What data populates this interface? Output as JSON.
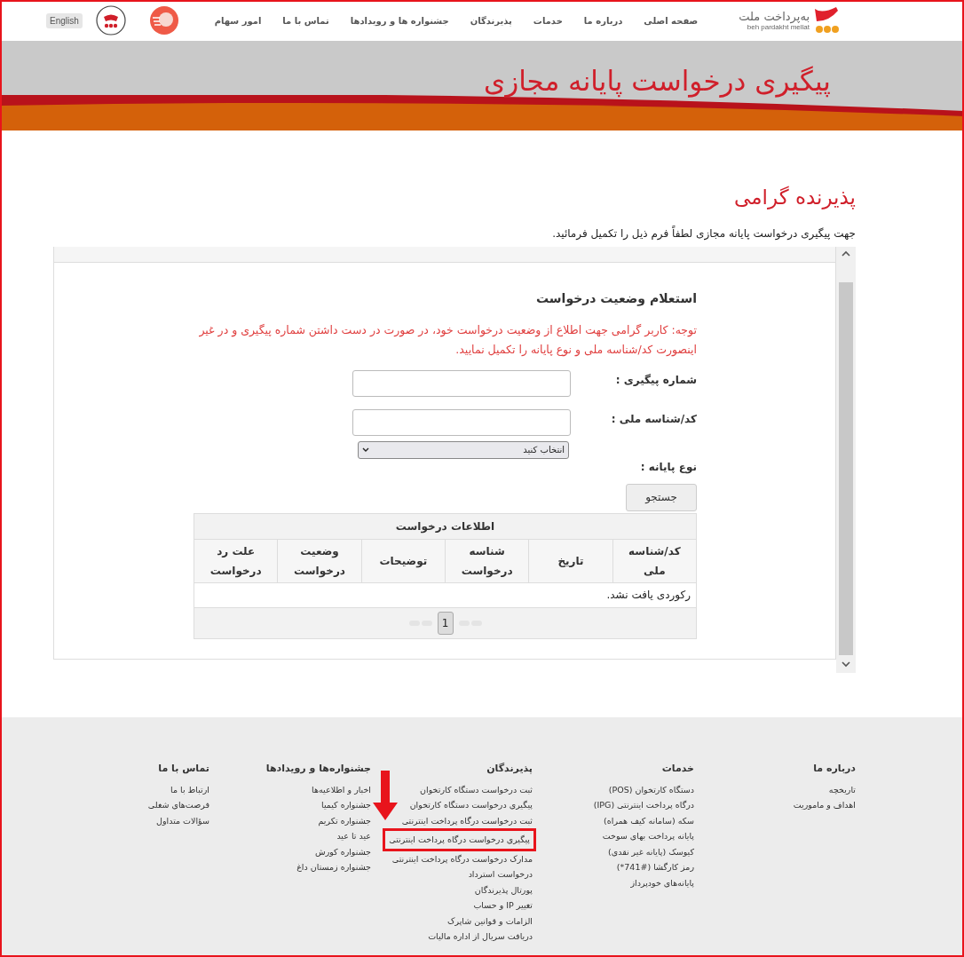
{
  "nav": {
    "logo": {
      "name": "به‌پرداخت ملت",
      "latin": "beh pardakht mellat"
    },
    "items": [
      "صفحه اصلی",
      "درباره ما",
      "خدمات",
      "پذیرندگان",
      "جشنواره ها و رویدادها",
      "تماس با ما",
      "امور سهام"
    ],
    "language": "English"
  },
  "header": {
    "title": "پیگیری درخواست پایانه مجازی"
  },
  "greeting": "پذیرنده گرامی",
  "intro": "جهت پیگیری درخواست پایانه مجازی لطفاً فرم ذیل را تکمیل فرمائید.",
  "form": {
    "title": "استعلام وضعیت درخواست",
    "notice": "توجه: کاربر گرامی جهت اطلاع از وضعیت درخواست خود، در صورت در دست داشتن شماره پیگیری و در غیر اینصورت کد/شناسه ملی و نوع پایانه را تکمیل نمایید.",
    "fields": [
      {
        "kind": "text",
        "label": "شماره پیگیری :"
      },
      {
        "kind": "text",
        "label": "کد/شناسه ملی :"
      },
      {
        "kind": "select",
        "label": "نوع پایانه :",
        "value": "انتخاب کنید"
      }
    ],
    "search_button": "جستجو"
  },
  "table": {
    "caption": "اطلاعات درخواست",
    "columns": [
      "کد/شناسه ملی",
      "تاریخ",
      "شناسه درخواست",
      "توضیحات",
      "وضعیت درخواست",
      "علت رد درخواست"
    ],
    "empty_message": "رکوردی یافت نشد.",
    "pages": [
      {
        "label": "1",
        "selected": true
      }
    ]
  },
  "footer": {
    "columns": [
      {
        "title": "درباره ما",
        "links": [
          {
            "label": "تاریخچه",
            "highlighted": false
          },
          {
            "label": "اهداف و ماموریت",
            "highlighted": false
          }
        ]
      },
      {
        "title": "خدمات",
        "links": [
          {
            "label": "دستگاه کارتخوان (POS)",
            "highlighted": false
          },
          {
            "label": "درگاه پرداخت اینترنتی (IPG)",
            "highlighted": false
          },
          {
            "label": "سکه (سامانه کیف همراه)",
            "highlighted": false
          },
          {
            "label": "پایانه پرداخت بهای سوخت",
            "highlighted": false
          },
          {
            "label": "کیوسک (پایانه غیر نقدی)",
            "highlighted": false
          },
          {
            "label": "رمز کارگشا (#741*)",
            "highlighted": false
          },
          {
            "label": "پایانه‌های خودپرداز",
            "highlighted": false
          }
        ]
      },
      {
        "title": "پذیرندگان",
        "links": [
          {
            "label": "ثبت درخواست دستگاه کارتخوان",
            "highlighted": false
          },
          {
            "label": "پیگیری درخواست دستگاه کارتخوان",
            "highlighted": false
          },
          {
            "label": "ثبت درخواست درگاه پرداخت اینترنتی",
            "highlighted": false
          },
          {
            "label": "پیگیری درخواست درگاه پرداخت اینترنتی",
            "highlighted": true
          },
          {
            "label": "مدارک درخواست درگاه پرداخت اینترنتی",
            "highlighted": false
          },
          {
            "label": "درخواست استرداد",
            "highlighted": false
          },
          {
            "label": "پورتال پذیرندگان",
            "highlighted": false
          },
          {
            "label": "تغییر IP و حساب",
            "highlighted": false
          },
          {
            "label": "الزامات و قوانین شاپرک",
            "highlighted": false
          },
          {
            "label": "دریافت سریال از اداره مالیات",
            "highlighted": false
          }
        ]
      },
      {
        "title": "جشنواره‌ها و رویدادها",
        "links": [
          {
            "label": "اخبار و اطلاعیه‌ها",
            "highlighted": false
          },
          {
            "label": "جشنواره کیمیا",
            "highlighted": false
          },
          {
            "label": "جشنواره تکریم",
            "highlighted": false
          },
          {
            "label": "عید تا عید",
            "highlighted": false
          },
          {
            "label": "جشنواره کورش",
            "highlighted": false
          },
          {
            "label": "جشنواره زمستان داغ",
            "highlighted": false
          }
        ]
      },
      {
        "title": "تماس با ما",
        "links": [
          {
            "label": "ارتباط با ما",
            "highlighted": false
          },
          {
            "label": "فرصت‌های شغلی",
            "highlighted": false
          },
          {
            "label": "سؤالات متداول",
            "highlighted": false
          }
        ]
      }
    ]
  }
}
